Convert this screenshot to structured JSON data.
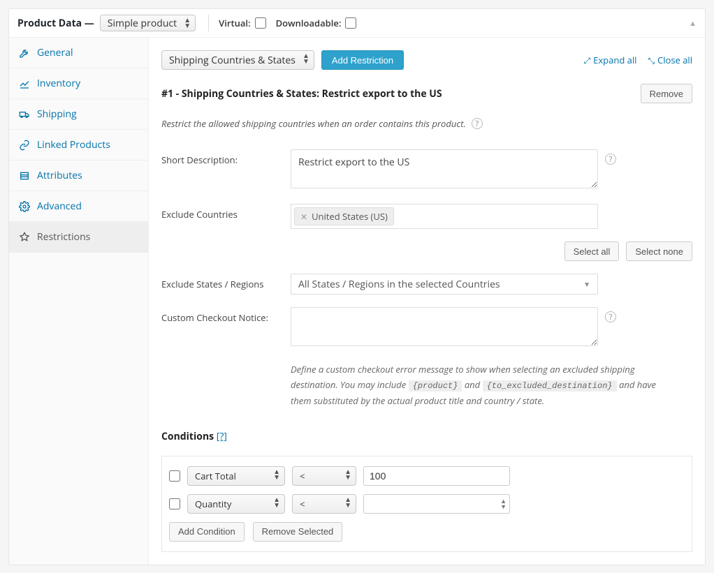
{
  "header": {
    "title": "Product Data —",
    "product_type": "Simple product",
    "virtual_label": "Virtual:",
    "downloadable_label": "Downloadable:"
  },
  "tabs": [
    {
      "label": "General",
      "icon": "wrench"
    },
    {
      "label": "Inventory",
      "icon": "chart"
    },
    {
      "label": "Shipping",
      "icon": "truck"
    },
    {
      "label": "Linked Products",
      "icon": "link"
    },
    {
      "label": "Attributes",
      "icon": "list"
    },
    {
      "label": "Advanced",
      "icon": "gear"
    },
    {
      "label": "Restrictions",
      "icon": "pin"
    }
  ],
  "toolbar": {
    "restriction_type": "Shipping Countries & States",
    "add_label": "Add Restriction",
    "expand_label": "Expand all",
    "close_label": "Close all"
  },
  "restriction": {
    "title": "#1 - Shipping Countries & States: Restrict export to the US",
    "remove_label": "Remove",
    "info_text": "Restrict the allowed shipping countries when an order contains this product.",
    "fields": {
      "short_description": {
        "label": "Short Description:",
        "value": "Restrict export to the US"
      },
      "exclude_countries": {
        "label": "Exclude Countries",
        "tags": [
          "United States (US)"
        ]
      },
      "select_all": "Select all",
      "select_none": "Select none",
      "exclude_states": {
        "label": "Exclude States / Regions",
        "value": "All States / Regions in the selected Countries"
      },
      "custom_notice": {
        "label": "Custom Checkout Notice:",
        "value": "",
        "hint_prefix": "Define a custom checkout error message to show when selecting an excluded shipping destination. You may include ",
        "chip1": "{product}",
        "and": " and ",
        "chip2": "{to_excluded_destination}",
        "hint_suffix": " and have them substituted by the actual product title and country / state."
      }
    },
    "conditions": {
      "title": "Conditions",
      "help_link": "[?]",
      "rows": [
        {
          "field": "Cart Total",
          "op": "<",
          "value": "100"
        },
        {
          "field": "Quantity",
          "op": "<",
          "value": ""
        }
      ],
      "add_label": "Add Condition",
      "remove_selected_label": "Remove Selected"
    }
  }
}
